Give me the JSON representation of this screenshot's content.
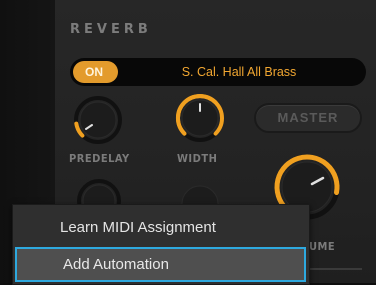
{
  "reverb": {
    "title": "REVERB",
    "on_label": "ON",
    "preset": "S. Cal. Hall All Brass",
    "master_label": "MASTER",
    "knobs": {
      "predelay": {
        "label": "PREDELAY",
        "value": 0.12
      },
      "width": {
        "label": "WIDTH",
        "value": 0.5
      },
      "volume": {
        "label": "UME",
        "value": 0.72
      },
      "lower_left": {
        "value": 0.0
      },
      "lower_mid": {
        "value": 0.5
      }
    }
  },
  "context_menu": {
    "items": [
      {
        "label": "Learn MIDI Assignment"
      },
      {
        "label": "Add Automation"
      }
    ]
  },
  "colors": {
    "accent": "#e39b2c",
    "preset_text": "#f2a731",
    "selection_border": "#2ea9df"
  }
}
